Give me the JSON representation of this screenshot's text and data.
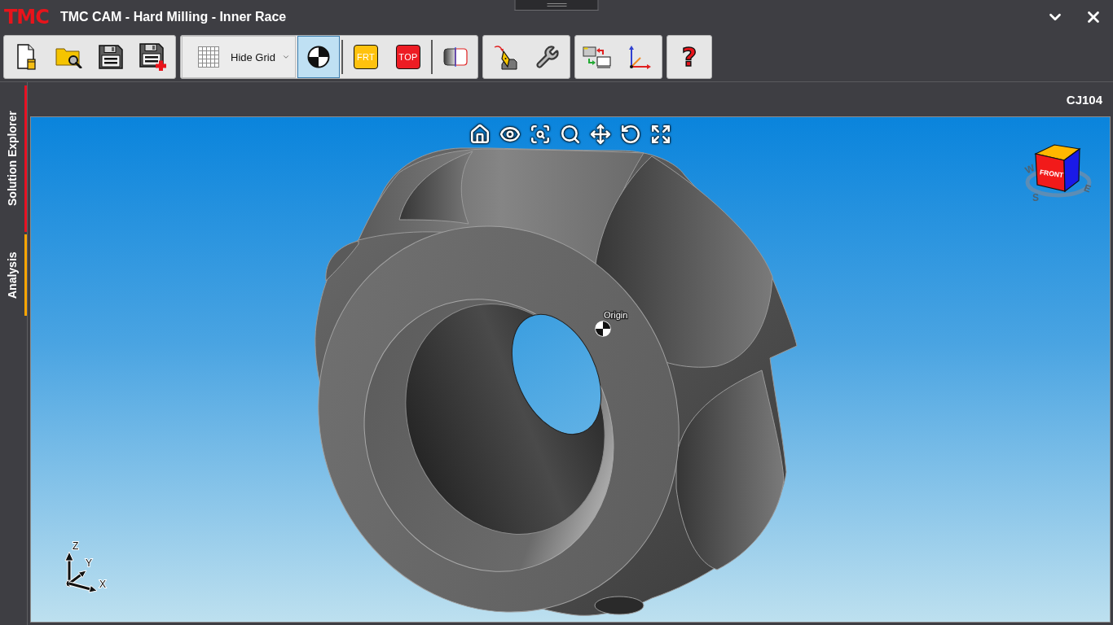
{
  "window": {
    "logo": "TMC",
    "title": "TMC CAM - Hard Milling - Inner Race"
  },
  "toolbar": {
    "groups": [
      {
        "sections": [
          {
            "buttons": [
              {
                "kind": "icon",
                "selected": false
              },
              {
                "kind": "icon",
                "selected": false
              },
              {
                "kind": "icon",
                "selected": false
              },
              {
                "kind": "icon",
                "selected": false
              }
            ]
          }
        ]
      },
      {
        "sections": [
          {
            "buttons": [
              {
                "kind": "dropdown",
                "label": "Hide Grid",
                "selected": false
              },
              {
                "kind": "icon",
                "selected": true
              }
            ]
          },
          {
            "buttons": [
              {
                "kind": "badge",
                "label": "FRT",
                "color": "#ffc20e",
                "selected": false
              },
              {
                "kind": "badge",
                "label": "TOP",
                "color": "#ed1c24",
                "selected": false
              }
            ]
          },
          {
            "buttons": [
              {
                "kind": "icon",
                "selected": false
              }
            ]
          }
        ]
      },
      {
        "sections": [
          {
            "buttons": [
              {
                "kind": "icon",
                "selected": false
              },
              {
                "kind": "icon",
                "selected": false
              }
            ]
          }
        ]
      },
      {
        "sections": [
          {
            "buttons": [
              {
                "kind": "icon",
                "selected": false
              },
              {
                "kind": "icon",
                "selected": false
              }
            ]
          }
        ]
      },
      {
        "sections": [
          {
            "buttons": [
              {
                "kind": "glyph",
                "label": "?",
                "selected": false
              }
            ]
          }
        ]
      }
    ]
  },
  "side_tabs": [
    {
      "label": "Solution Explorer",
      "color": "#e81123"
    },
    {
      "label": "Analysis",
      "color": "#ffa500"
    }
  ],
  "document": {
    "name": "CJ104"
  },
  "viewport": {
    "origin": {
      "label": "Origin"
    },
    "view_cube": {
      "face_label": "FRONT",
      "compass": [
        "W",
        "E",
        "S"
      ]
    },
    "axes": [
      "Z",
      "Y",
      "X"
    ]
  }
}
